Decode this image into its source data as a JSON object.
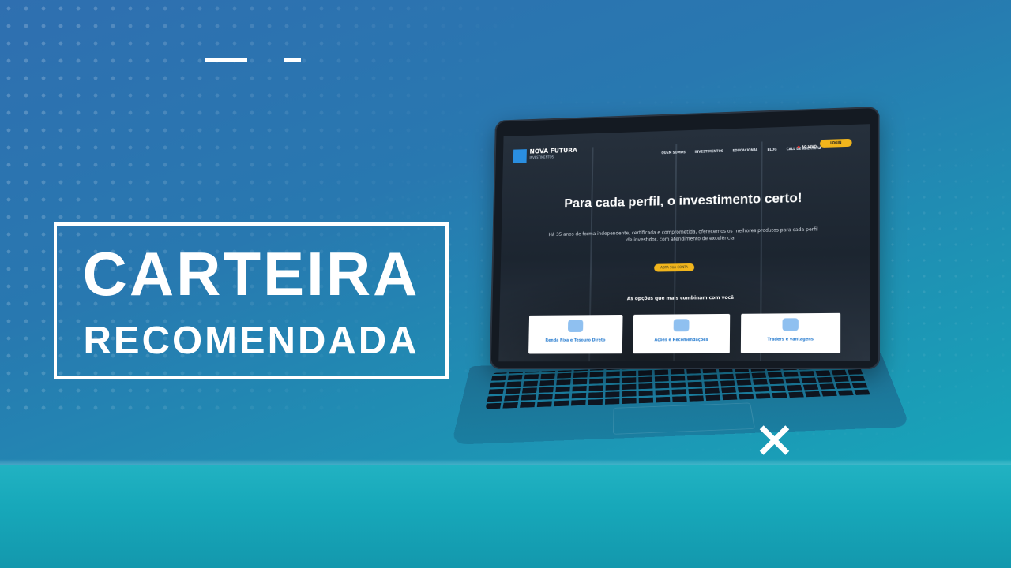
{
  "headline": {
    "line1": "CARTEIRA",
    "line2": "RECOMENDADA"
  },
  "site": {
    "brand": "NOVA FUTURA",
    "brand_sub": "INVESTIMENTOS",
    "nav": [
      "QUEM SOMOS",
      "INVESTIMENTOS",
      "EDUCACIONAL",
      "BLOG",
      "CALL DE ABERTURA"
    ],
    "live_label": "AO VIVO",
    "login_label": "LOGIN",
    "hero_title": "Para cada perfil, o investimento certo!",
    "hero_text": "Há 35 anos de forma independente, certificada e comprometida, oferecemos os melhores produtos para cada perfil de investidor, com atendimento de excelência.",
    "cta_label": "ABRA SUA CONTA",
    "options_heading": "As opções que mais combinam com você",
    "cards": [
      {
        "label": "Renda Fixa e Tesouro Direto",
        "icon": "piggy-bank-icon"
      },
      {
        "label": "Ações e Recomendações",
        "icon": "money-envelope-icon"
      },
      {
        "label": "Traders e vantagens",
        "icon": "rising-chart-icon"
      }
    ]
  },
  "colors": {
    "background_top": "#2f6fb0",
    "background_bottom": "#14aebb",
    "accent_yellow": "#f1b51c",
    "card_text": "#2b7ed0"
  }
}
